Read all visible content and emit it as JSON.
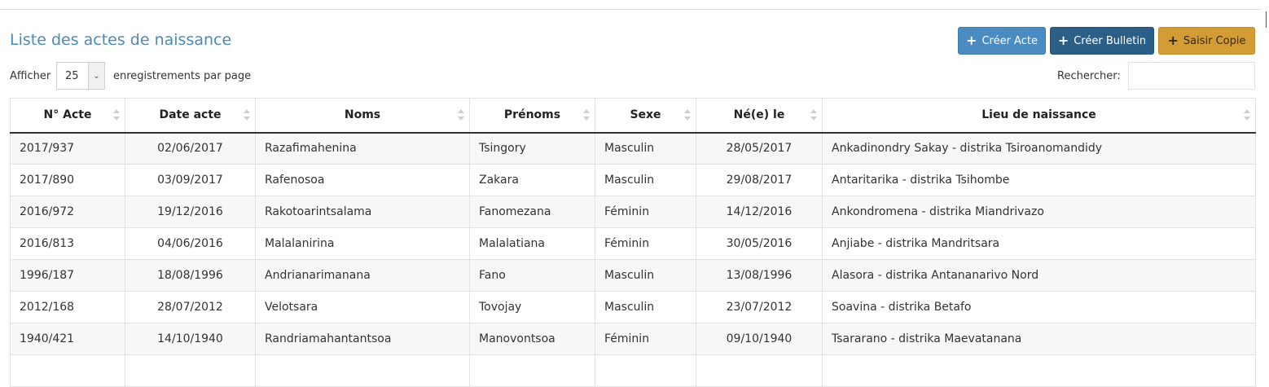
{
  "page": {
    "title": "Liste des actes de naissance"
  },
  "toolbar": {
    "create_acte": "Créer Acte",
    "create_bulletin": "Créer Bulletin",
    "saisir_copie": "Saisir Copie",
    "button_colors": {
      "acte": "#4a8bc2",
      "bulletin": "#2b5f88",
      "copie": "#d49c35"
    }
  },
  "length": {
    "label": "Afficher",
    "value": "25",
    "suffix": "enregistrements par page"
  },
  "search": {
    "label": "Rechercher:",
    "value": ""
  },
  "table": {
    "headers": [
      "N° Acte",
      "Date acte",
      "Noms",
      "Prénoms",
      "Sexe",
      "Né(e) le",
      "Lieu de naissance"
    ],
    "rows": [
      [
        "2017/937",
        "02/06/2017",
        "Razafimahenina",
        "Tsingory",
        "Masculin",
        "28/05/2017",
        "Ankadinondry Sakay - distrika Tsiroanomandidy"
      ],
      [
        "2017/890",
        "03/09/2017",
        "Rafenosoa",
        "Zakara",
        "Masculin",
        "29/08/2017",
        "Antaritarika - distrika Tsihombe"
      ],
      [
        "2016/972",
        "19/12/2016",
        "Rakotoarintsalama",
        "Fanomezana",
        "Féminin",
        "14/12/2016",
        "Ankondromena - distrika Miandrivazo"
      ],
      [
        "2016/813",
        "04/06/2016",
        "Malalanirina",
        "Malalatiana",
        "Féminin",
        "30/05/2016",
        "Anjiabe - distrika Mandritsara"
      ],
      [
        "1996/187",
        "18/08/1996",
        "Andrianarimanana",
        "Fano",
        "Masculin",
        "13/08/1996",
        "Alasora - distrika Antananarivo Nord"
      ],
      [
        "2012/168",
        "28/07/2012",
        "Velotsara",
        "Tovojay",
        "Masculin",
        "23/07/2012",
        "Soavina - distrika Betafo"
      ],
      [
        "1940/421",
        "14/10/1940",
        "Randriamahantantsoa",
        "Manovontsoa",
        "Féminin",
        "09/10/1940",
        "Tsararano - distrika Maevatanana"
      ],
      [
        "",
        "",
        "",
        "",
        "",
        "",
        ""
      ]
    ]
  }
}
